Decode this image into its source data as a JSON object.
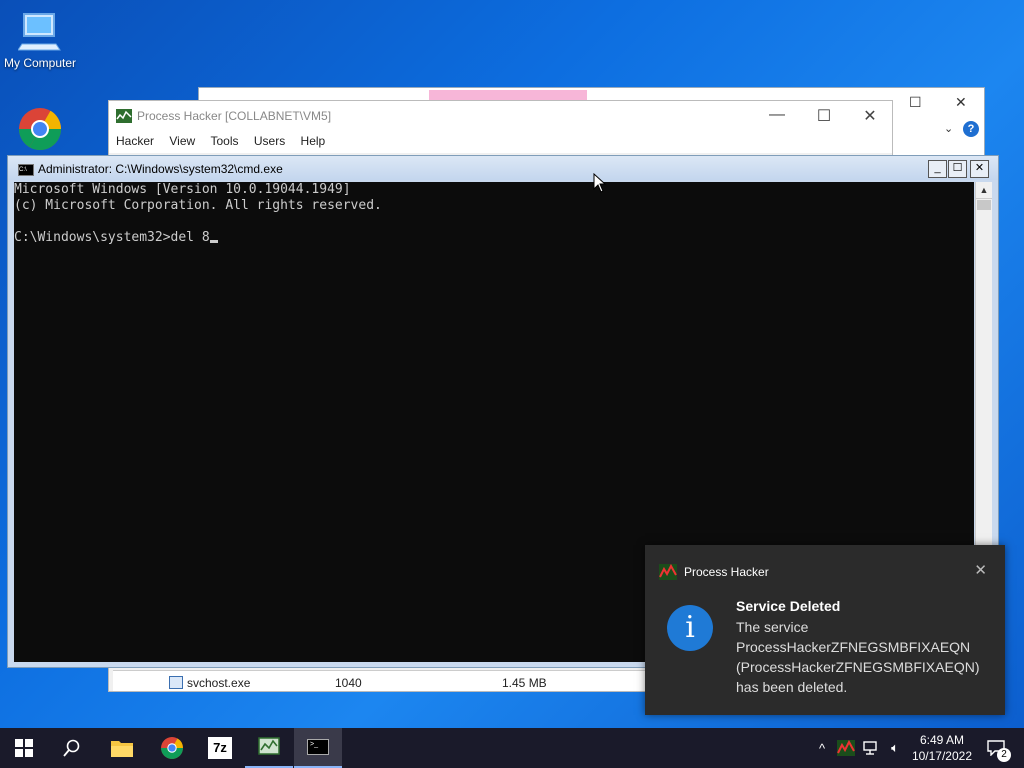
{
  "desktop": {
    "icons": [
      {
        "label": "My Computer"
      }
    ]
  },
  "process_hacker": {
    "title": "Process Hacker [COLLABNET\\VM5]",
    "menu": [
      "Hacker",
      "View",
      "Tools",
      "Users",
      "Help"
    ],
    "visible_row": {
      "name": "svchost.exe",
      "pid": "1040",
      "memory": "1.45 MB"
    }
  },
  "cmd": {
    "title": "Administrator: C:\\Windows\\system32\\cmd.exe",
    "lines": [
      "Microsoft Windows [Version 10.0.19044.1949]",
      "(c) Microsoft Corporation. All rights reserved.",
      "",
      "C:\\Windows\\system32>del 8"
    ]
  },
  "toast": {
    "app_name": "Process Hacker",
    "heading": "Service Deleted",
    "body": "The service ProcessHackerZFNEGSMBFIXAEQN (ProcessHackerZFNEGSMBFIXAEQN) has been deleted."
  },
  "taskbar": {
    "time": "6:49 AM",
    "date": "10/17/2022",
    "notification_count": "2"
  },
  "colors": {
    "accent": "#1f7ad6",
    "console_bg": "#0c0c0c"
  }
}
